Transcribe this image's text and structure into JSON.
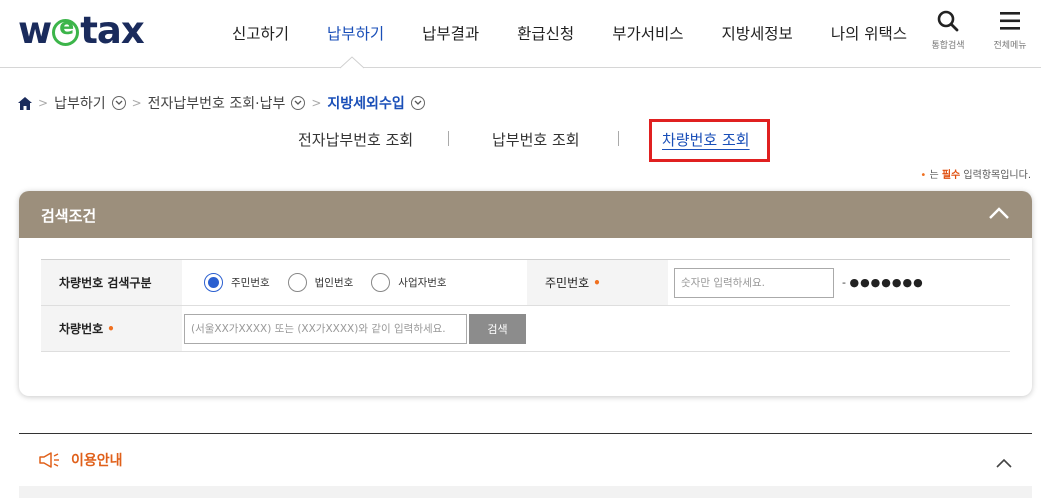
{
  "logo": {
    "pre": "w",
    "post": "tax"
  },
  "nav": {
    "items": [
      {
        "label": "신고하기",
        "active": false
      },
      {
        "label": "납부하기",
        "active": true
      },
      {
        "label": "납부결과",
        "active": false
      },
      {
        "label": "환급신청",
        "active": false
      },
      {
        "label": "부가서비스",
        "active": false
      },
      {
        "label": "지방세정보",
        "active": false
      },
      {
        "label": "나의 위택스",
        "active": false
      }
    ],
    "search_label": "통합검색",
    "menu_label": "전체메뉴"
  },
  "breadcrumb": {
    "items": [
      "납부하기",
      "전자납부번호 조회·납부",
      "지방세외수입"
    ]
  },
  "subtabs": {
    "items": [
      "전자납부번호 조회",
      "납부번호 조회",
      "차량번호 조회"
    ],
    "active_index": 2
  },
  "required_note": {
    "dot": "•",
    "prefix": "는 ",
    "strong": "필수",
    "suffix": " 입력항목입니다."
  },
  "search_panel": {
    "title": "검색조건",
    "row1": {
      "label": "차량번호 검색구분",
      "radios": [
        {
          "label": "주민번호",
          "checked": true
        },
        {
          "label": "법인번호",
          "checked": false
        },
        {
          "label": "사업자번호",
          "checked": false
        }
      ],
      "id_label": "주민번호",
      "id_placeholder": "숫자만 입력하세요.",
      "masked_prefix": "-",
      "masked_dots": "●●●●●●●"
    },
    "row2": {
      "label": "차량번호",
      "placeholder": "(서울XX가XXXX) 또는 (XX가XXXX)와 같이 입력하세요.",
      "button": "검색"
    }
  },
  "guide": {
    "title": "이용안내"
  },
  "colors": {
    "accent": "#1a4fb8",
    "panel_header": "#9c8f7c",
    "highlight": "#e02020",
    "required": "#f07020",
    "logo_e": "#3cb54a"
  }
}
